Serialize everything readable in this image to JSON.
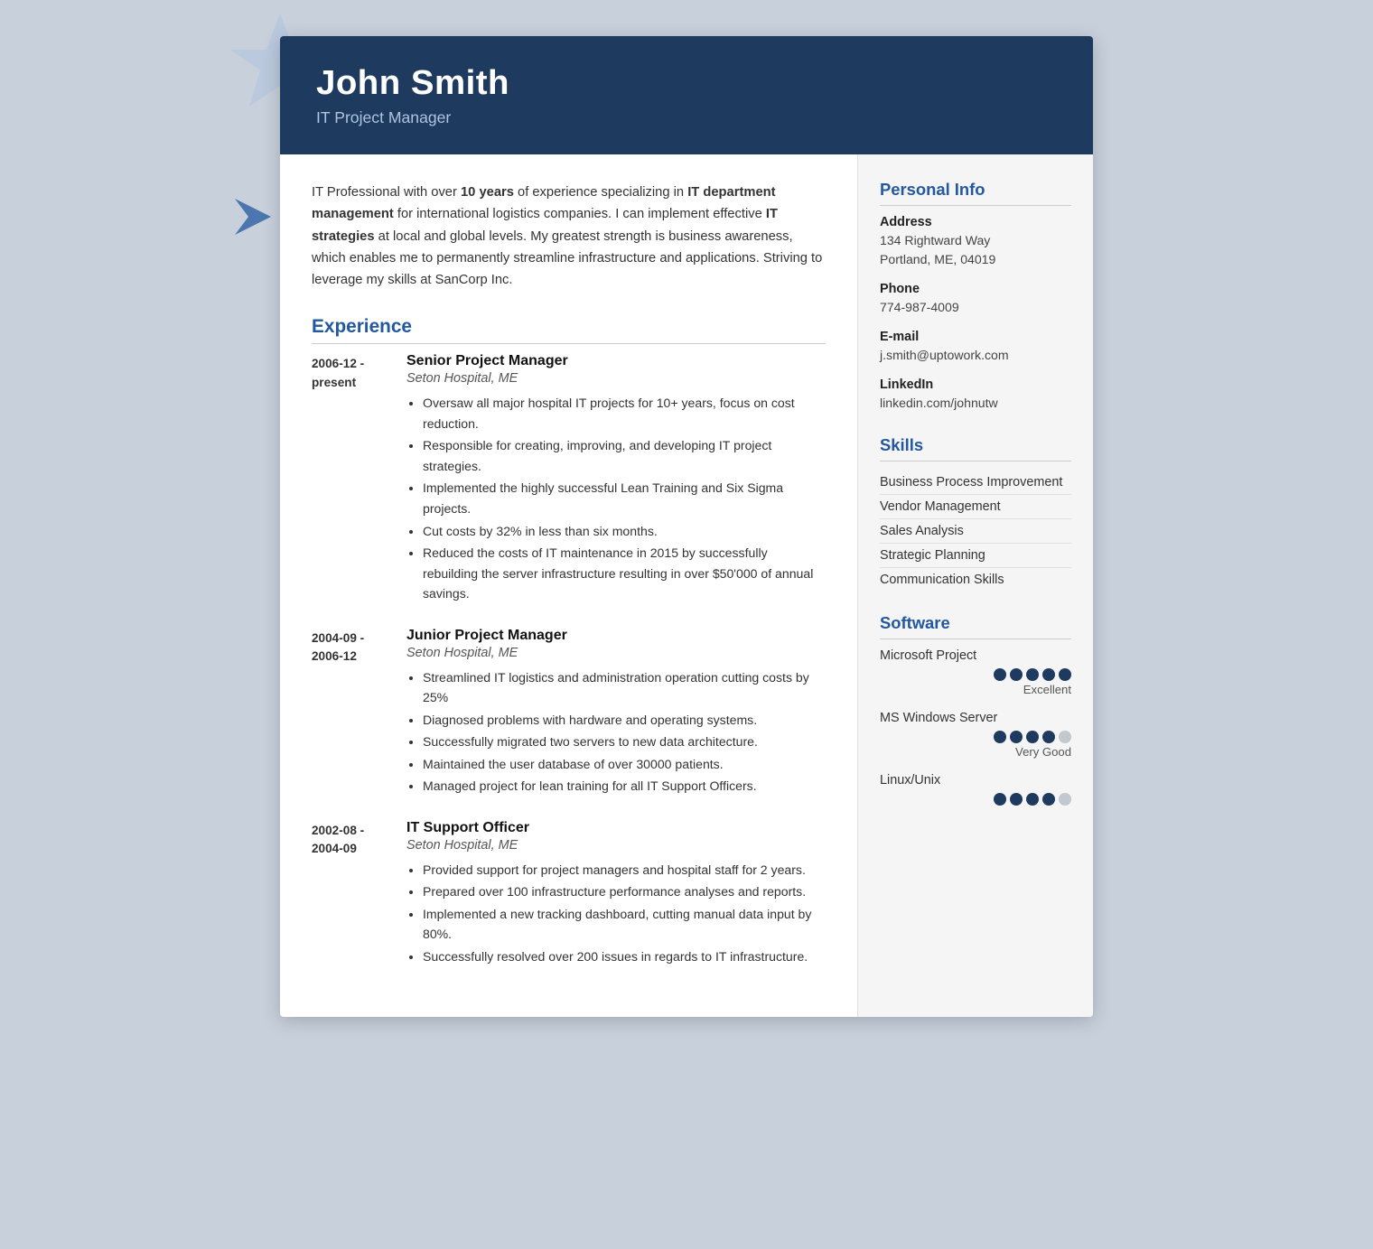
{
  "header": {
    "name": "John Smith",
    "title": "IT Project Manager"
  },
  "summary": {
    "text_parts": [
      {
        "text": "IT Professional with over ",
        "bold": false
      },
      {
        "text": "10 years",
        "bold": true
      },
      {
        "text": " of experience specializing in ",
        "bold": false
      },
      {
        "text": "IT department management",
        "bold": true
      },
      {
        "text": " for international logistics companies. I can implement effective ",
        "bold": false
      },
      {
        "text": "IT strategies",
        "bold": true
      },
      {
        "text": " at local and global levels. My greatest strength is business awareness, which enables me to permanently streamline infrastructure and applications. Striving to leverage my skills at SanCorp Inc.",
        "bold": false
      }
    ]
  },
  "experience": {
    "section_title": "Experience",
    "items": [
      {
        "date_start": "2006-12 -",
        "date_end": "present",
        "job_title": "Senior Project Manager",
        "company": "Seton Hospital, ME",
        "bullets": [
          "Oversaw all major hospital IT projects for 10+ years, focus on cost reduction.",
          "Responsible for creating, improving, and developing IT project strategies.",
          "Implemented the highly successful Lean Training and Six Sigma projects.",
          "Cut costs by 32% in less than six months.",
          "Reduced the costs of IT maintenance in 2015 by successfully rebuilding the server infrastructure resulting in over $50'000 of annual savings."
        ]
      },
      {
        "date_start": "2004-09 -",
        "date_end": "2006-12",
        "job_title": "Junior Project Manager",
        "company": "Seton Hospital, ME",
        "bullets": [
          "Streamlined IT logistics and administration operation cutting costs by 25%",
          "Diagnosed problems with hardware and operating systems.",
          "Successfully migrated two servers to new data architecture.",
          "Maintained the user database of over 30000 patients.",
          "Managed project for lean training for all IT Support Officers."
        ]
      },
      {
        "date_start": "2002-08 -",
        "date_end": "2004-09",
        "job_title": "IT Support Officer",
        "company": "Seton Hospital, ME",
        "bullets": [
          "Provided support for project managers and hospital staff for 2 years.",
          "Prepared over 100 infrastructure performance analyses and reports.",
          "Implemented a new tracking dashboard, cutting manual data input by 80%.",
          "Successfully resolved over 200 issues in regards to IT infrastructure."
        ]
      }
    ]
  },
  "sidebar": {
    "personal_info": {
      "section_title": "Personal Info",
      "fields": [
        {
          "label": "Address",
          "value": "134 Rightward Way\nPortland, ME, 04019"
        },
        {
          "label": "Phone",
          "value": "774-987-4009"
        },
        {
          "label": "E-mail",
          "value": "j.smith@uptowork.com"
        },
        {
          "label": "LinkedIn",
          "value": "linkedin.com/johnutw"
        }
      ]
    },
    "skills": {
      "section_title": "Skills",
      "items": [
        "Business Process Improvement",
        "Vendor Management",
        "Sales Analysis",
        "Strategic Planning",
        "Communication Skills"
      ]
    },
    "software": {
      "section_title": "Software",
      "items": [
        {
          "name": "Microsoft Project",
          "rating": 5,
          "max": 5,
          "label": "Excellent"
        },
        {
          "name": "MS Windows Server",
          "rating": 4,
          "max": 5,
          "label": "Very Good"
        },
        {
          "name": "Linux/Unix",
          "rating": 4,
          "max": 5,
          "label": ""
        }
      ]
    }
  }
}
